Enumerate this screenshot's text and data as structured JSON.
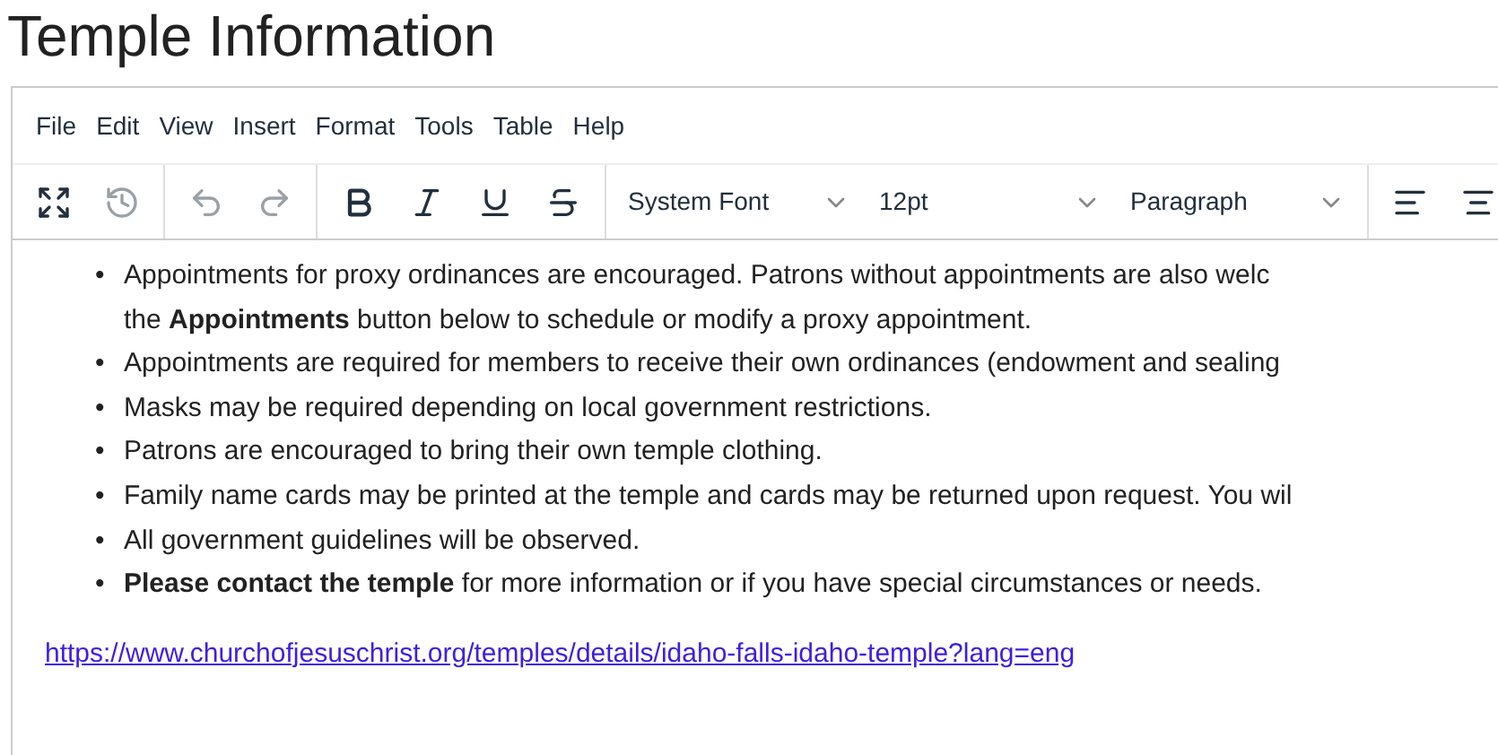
{
  "page_title": "Temple Information",
  "menu": [
    "File",
    "Edit",
    "View",
    "Insert",
    "Format",
    "Tools",
    "Table",
    "Help"
  ],
  "toolbar_groups": [
    [
      {
        "kind": "fullscreen",
        "disabled": false
      },
      {
        "kind": "history",
        "disabled": true
      }
    ],
    [
      {
        "kind": "undo",
        "disabled": true
      },
      {
        "kind": "redo",
        "disabled": true
      }
    ],
    [
      {
        "kind": "bold",
        "disabled": false
      },
      {
        "kind": "italic",
        "disabled": false
      },
      {
        "kind": "underline",
        "disabled": false
      },
      {
        "kind": "strikethrough",
        "disabled": false
      }
    ]
  ],
  "selects": [
    {
      "value": "System Font"
    },
    {
      "value": "12pt"
    },
    {
      "value": "Paragraph"
    }
  ],
  "align_buttons": [
    {
      "kind": "align-left"
    },
    {
      "kind": "align-center"
    }
  ],
  "list_items": [
    {
      "marker": "•",
      "lines": [
        "Appointments for proxy ordinances are encouraged. Patrons without appointments are also welc",
        "the **Appointments** button below to schedule or modify a proxy appointment."
      ]
    },
    {
      "marker": "•",
      "lines": [
        "Appointments are required for members to receive their own ordinances (endowment and sealing"
      ]
    },
    {
      "marker": "•",
      "lines": [
        "Masks may be required depending on local government restrictions."
      ]
    },
    {
      "marker": "•",
      "lines": [
        "Patrons are encouraged to bring their own temple clothing."
      ]
    },
    {
      "marker": "•",
      "lines": [
        "Family name cards may be printed at the temple and cards may be returned upon request. You wil"
      ]
    },
    {
      "marker": "•",
      "lines": [
        "All government guidelines will be observed."
      ]
    },
    {
      "marker": "•",
      "lines": [
        "**Please contact the temple** for more information or if you have special circumstances or needs."
      ]
    }
  ],
  "link": "https://www.churchofjesuschrist.org/temples/details/idaho-falls-idaho-temple?lang=eng"
}
